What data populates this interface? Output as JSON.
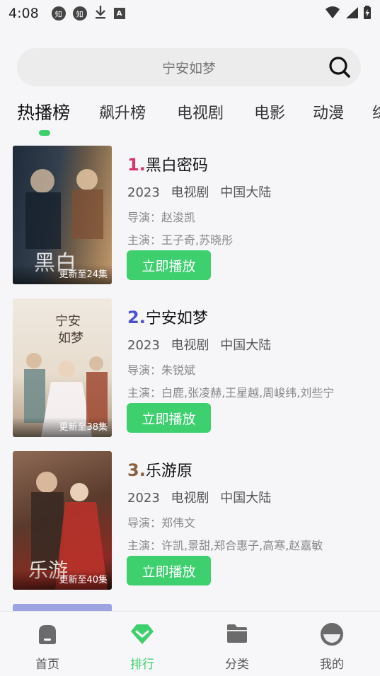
{
  "status_bar": {
    "time": "4:08",
    "icons": [
      "zhihu-icon",
      "zhihu-icon",
      "download-icon",
      "font-icon"
    ],
    "icon_glyph_zhihu": "知",
    "icon_glyph_font": "A"
  },
  "search": {
    "text": "宁安如梦"
  },
  "tabs": [
    {
      "label": "热播榜",
      "active": true
    },
    {
      "label": "飙升榜"
    },
    {
      "label": "电视剧"
    },
    {
      "label": "电影"
    },
    {
      "label": "动漫"
    },
    {
      "label": "综"
    }
  ],
  "rankings": [
    {
      "rank": "1.",
      "rank_color": "#d6336c",
      "title": "黑白密码",
      "year": "2023",
      "category": "电视剧",
      "region": "中国大陆",
      "director": "导演：赵浚凯",
      "cast": "主演：王子奇,苏晓彤",
      "badge": "更新至24集",
      "play_label": "立即播放"
    },
    {
      "rank": "2.",
      "rank_color": "#4b4fd6",
      "title": "宁安如梦",
      "year": "2023",
      "category": "电视剧",
      "region": "中国大陆",
      "director": "导演：朱锐斌",
      "cast": "主演：白鹿,张凌赫,王星越,周峻纬,刘些宁",
      "badge": "更新至38集",
      "play_label": "立即播放"
    },
    {
      "rank": "3.",
      "rank_color": "#8a6240",
      "title": "乐游原",
      "year": "2023",
      "category": "电视剧",
      "region": "中国大陆",
      "director": "导演：郑伟文",
      "cast": "主演：许凯,景甜,郑合惠子,高寒,赵嘉敏",
      "badge": "更新至40集",
      "play_label": "立即播放"
    }
  ],
  "bottom_nav": [
    {
      "label": "首页",
      "icon": "home-icon"
    },
    {
      "label": "排行",
      "icon": "ranking-icon",
      "active": true
    },
    {
      "label": "分类",
      "icon": "folder-icon"
    },
    {
      "label": "我的",
      "icon": "profile-icon"
    }
  ],
  "colors": {
    "accent": "#3ecf6f"
  }
}
